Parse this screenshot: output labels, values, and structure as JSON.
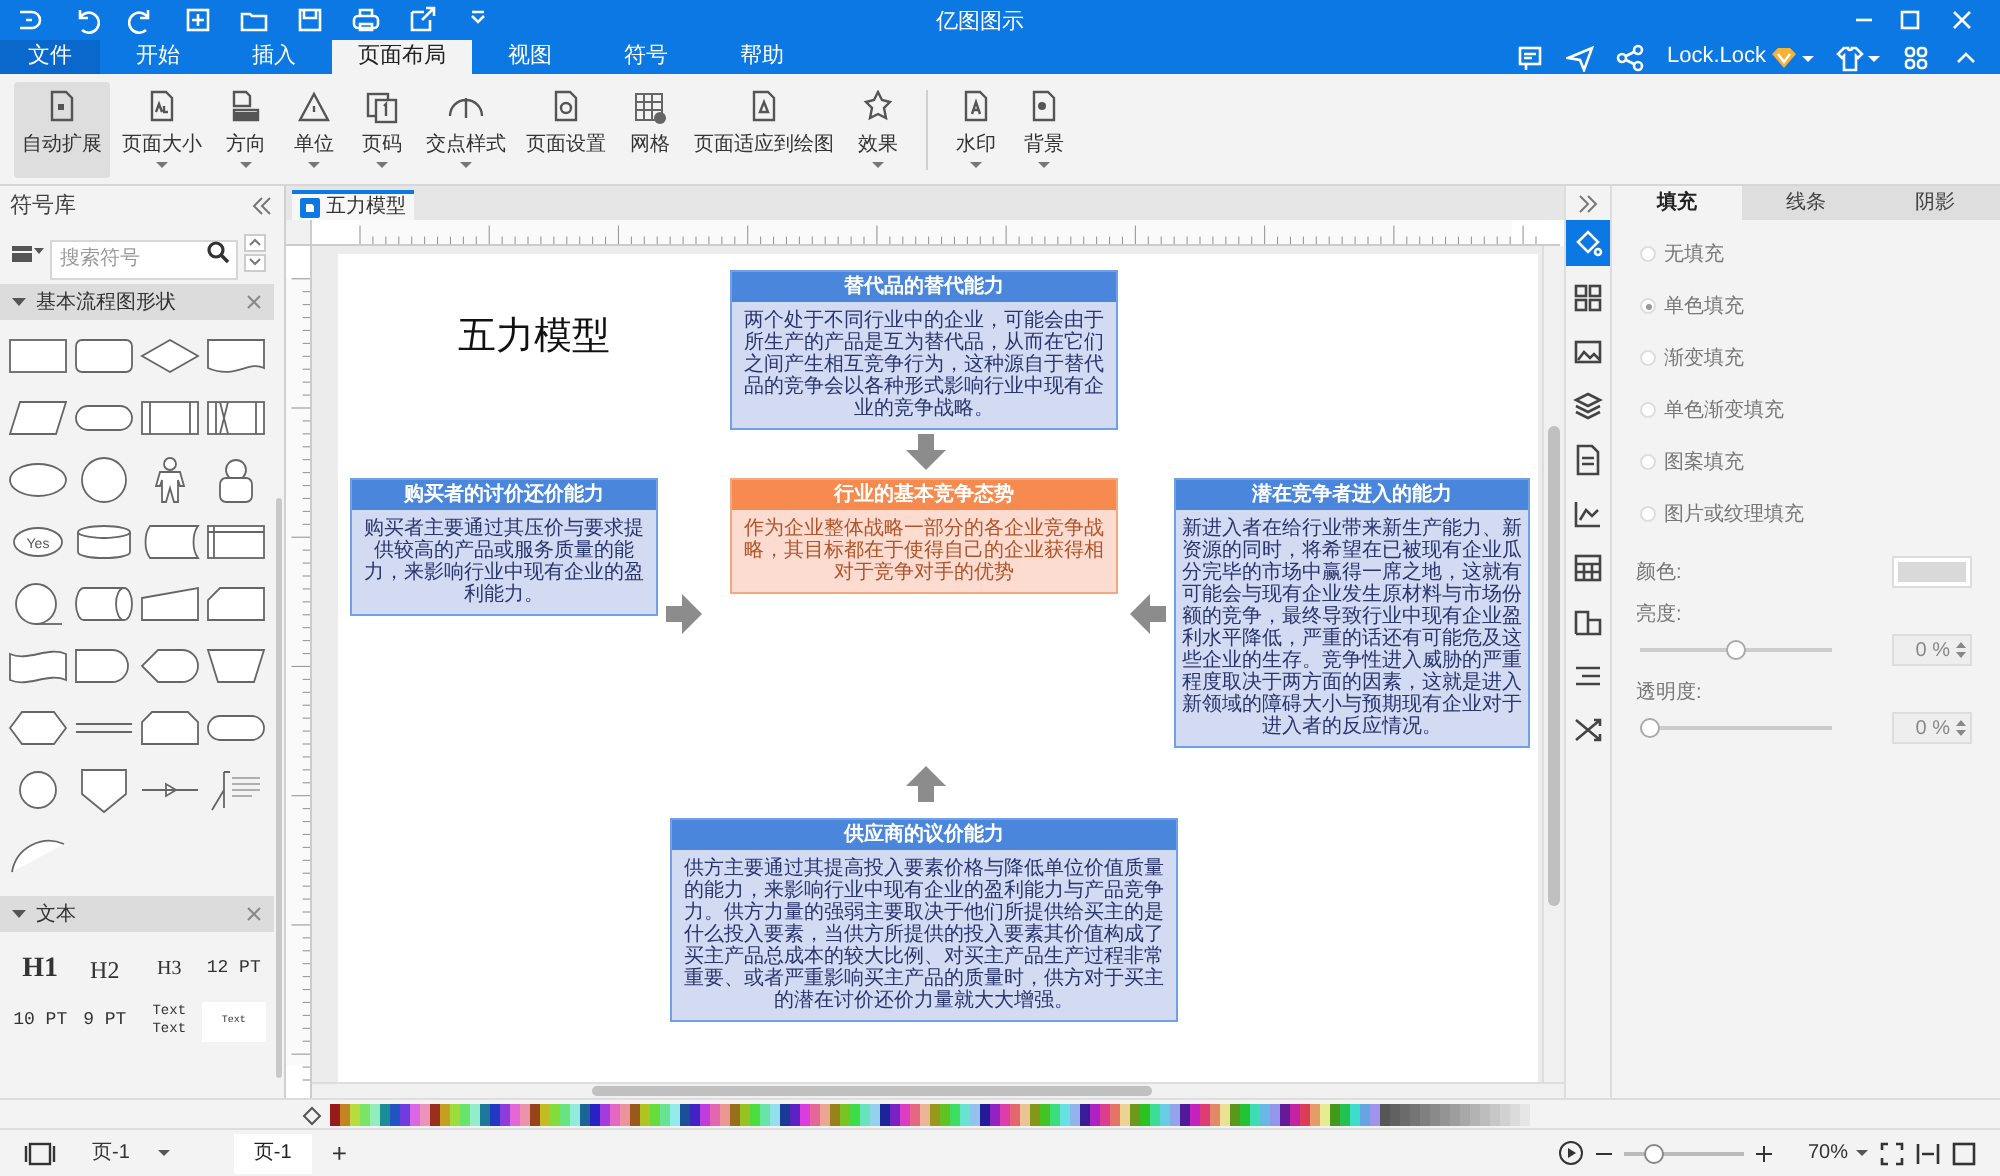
{
  "window": {
    "title": "亿图图示",
    "account": "Lock.Lock"
  },
  "menu_tabs": [
    {
      "label": "文件",
      "kind": "file",
      "selected": false
    },
    {
      "label": "开始",
      "kind": "tab",
      "selected": false
    },
    {
      "label": "插入",
      "kind": "tab",
      "selected": false
    },
    {
      "label": "页面布局",
      "kind": "tab",
      "selected": true
    },
    {
      "label": "视图",
      "kind": "tab",
      "selected": false
    },
    {
      "label": "符号",
      "kind": "tab",
      "selected": false
    },
    {
      "label": "帮助",
      "kind": "tab",
      "selected": false
    }
  ],
  "ribbon_groups": [
    {
      "items": [
        {
          "label": "自动扩展",
          "dropdown": false,
          "selected": true
        },
        {
          "label": "页面大小",
          "dropdown": true,
          "selected": false
        },
        {
          "label": "方向",
          "dropdown": true,
          "selected": false
        },
        {
          "label": "单位",
          "dropdown": true,
          "selected": false
        },
        {
          "label": "页码",
          "dropdown": true,
          "selected": false
        },
        {
          "label": "交点样式",
          "dropdown": true,
          "selected": false
        },
        {
          "label": "页面设置",
          "dropdown": false,
          "selected": false
        },
        {
          "label": "网格",
          "dropdown": false,
          "selected": false
        },
        {
          "label": "页面适应到绘图",
          "dropdown": false,
          "selected": false
        },
        {
          "label": "效果",
          "dropdown": true,
          "selected": false
        }
      ]
    },
    {
      "items": [
        {
          "label": "水印",
          "dropdown": true,
          "selected": false
        },
        {
          "label": "背景",
          "dropdown": true,
          "selected": false
        }
      ]
    }
  ],
  "library": {
    "title": "符号库",
    "search": {
      "placeholder": "搜索符号"
    },
    "sections": [
      {
        "title": "基本流程图形状",
        "expanded": true,
        "shape_label": "Yes"
      },
      {
        "title": "文本",
        "expanded": true,
        "items": [
          {
            "kind": "h1",
            "lines": [
              "H1"
            ]
          },
          {
            "kind": "h2",
            "lines": [
              "H2"
            ]
          },
          {
            "kind": "h3",
            "lines": [
              "H3"
            ]
          },
          {
            "kind": "pt",
            "lines": [
              "12 PT"
            ]
          },
          {
            "kind": "pt",
            "lines": [
              "10 PT"
            ]
          },
          {
            "kind": "pt",
            "lines": [
              "9 PT"
            ]
          },
          {
            "kind": "pair",
            "lines": [
              "Text",
              "Text"
            ]
          },
          {
            "kind": "thumb",
            "lines": [
              "Text"
            ]
          }
        ]
      }
    ]
  },
  "document_tab": {
    "title": "五力模型"
  },
  "diagram": {
    "title": "五力模型",
    "boxes": [
      {
        "kind": "force",
        "title": "替代品的替代能力",
        "body": "两个处于不同行业中的企业，可能会由于所生产的产品是互为替代品，从而在它们之间产生相互竞争行为，这种源自于替代品的竞争会以各种形式影响行业中现有企业的竞争战略。"
      },
      {
        "kind": "force",
        "title": "购买者的讨价还价能力",
        "body": "购买者主要通过其压价与要求提供较高的产品或服务质量的能力，来影响行业中现有企业的盈利能力。"
      },
      {
        "kind": "core",
        "title": "行业的基本竞争态势",
        "body": "作为企业整体战略一部分的各企业竞争战略，其目标都在于使得自己的企业获得相对于竞争对手的优势"
      },
      {
        "kind": "force",
        "title": "潜在竞争者进入的能力",
        "body": "新进入者在给行业带来新生产能力、新资源的同时，将希望在已被现有企业瓜分完毕的市场中赢得一席之地，这就有可能会与现有企业发生原材料与市场份额的竞争，最终导致行业中现有企业盈利水平降低，严重的话还有可能危及这些企业的生存。竞争性进入威胁的严重程度取决于两方面的因素，这就是进入新领域的障碍大小与预期现有企业对于进入者的反应情况。"
      },
      {
        "kind": "force",
        "title": "供应商的议价能力",
        "body": "供方主要通过其提高投入要素价格与降低单位价值质量的能力，来影响行业中现有企业的盈利能力与产品竞争力。供方力量的强弱主要取决于他们所提供给买主的是什么投入要素，当供方所提供的投入要素其价值构成了买主产品总成本的较大比例、对买主产品生产过程非常重要、或者严重影响买主产品的质量时，供方对于买主的潜在讨价还价力量就大大增强。"
      }
    ]
  },
  "side_tools": [
    {
      "selected": true
    },
    {
      "selected": false
    },
    {
      "selected": false
    },
    {
      "selected": false
    },
    {
      "selected": false
    },
    {
      "selected": false
    },
    {
      "selected": false
    },
    {
      "selected": false
    },
    {
      "selected": false
    },
    {
      "selected": false
    }
  ],
  "format_panel": {
    "tabs": [
      {
        "label": "填充",
        "selected": true
      },
      {
        "label": "线条",
        "selected": false
      },
      {
        "label": "阴影",
        "selected": false
      }
    ],
    "fill_options": [
      {
        "label": "无填充",
        "selected": false
      },
      {
        "label": "单色填充",
        "selected": true
      },
      {
        "label": "渐变填充",
        "selected": false
      },
      {
        "label": "单色渐变填充",
        "selected": false
      },
      {
        "label": "图案填充",
        "selected": false
      },
      {
        "label": "图片或纹理填充",
        "selected": false
      }
    ],
    "color_label": "颜色:",
    "sliders": [
      {
        "label": "亮度:",
        "level": 0.5,
        "reading": "0 %"
      },
      {
        "label": "透明度:",
        "level": 0,
        "reading": "0 %"
      }
    ]
  },
  "status_bar": {
    "page_selector": "页-1",
    "page_tabs": [
      {
        "label": "页-1",
        "selected": true
      }
    ],
    "add_page": "+",
    "zoom": {
      "level": 0.2,
      "reading": "70%"
    }
  }
}
